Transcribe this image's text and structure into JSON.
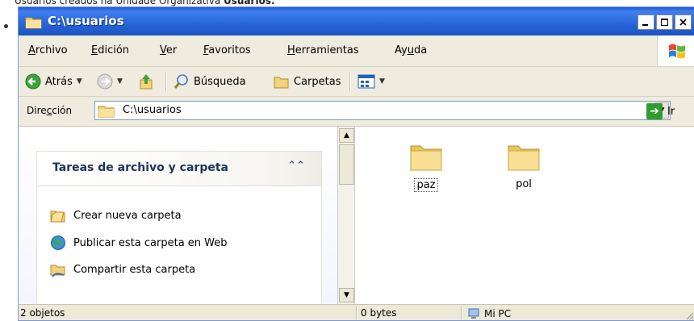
{
  "caption": {
    "prefix": "Usuarios creados na Unidade Organizativa ",
    "bold": "Usuarios."
  },
  "window": {
    "title": "C:\\usuarios"
  },
  "menu": {
    "items": [
      {
        "pre": "",
        "u": "A",
        "post": "rchivo"
      },
      {
        "pre": "",
        "u": "E",
        "post": "dición"
      },
      {
        "pre": "",
        "u": "V",
        "post": "er"
      },
      {
        "pre": "",
        "u": "F",
        "post": "avoritos"
      },
      {
        "pre": "",
        "u": "H",
        "post": "erramientas"
      },
      {
        "pre": "Ay",
        "u": "u",
        "post": "da"
      }
    ]
  },
  "toolbar": {
    "back_label": "Atrás",
    "search_label": "Búsqueda",
    "folders_label": "Carpetas"
  },
  "address": {
    "label_pre": "Dire",
    "label_u": "c",
    "label_post": "ción",
    "value": "C:\\usuarios",
    "go_label": "Ir"
  },
  "tasks": {
    "title": "Tareas de archivo y carpeta",
    "collapse_icon": "double-chevron-up-icon",
    "items": [
      {
        "label": "Crear nueva carpeta",
        "icon": "new-folder-icon"
      },
      {
        "label": "Publicar esta carpeta en Web",
        "icon": "web-publish-icon"
      },
      {
        "label": "Compartir esta carpeta",
        "icon": "share-folder-icon"
      }
    ]
  },
  "files": [
    {
      "name": "paz",
      "selected": true
    },
    {
      "name": "pol",
      "selected": false
    }
  ],
  "status": {
    "objects": "2 objetos",
    "size": "0 bytes",
    "location": "Mi PC"
  },
  "colors": {
    "titlebar": "#2b67d9",
    "window_bg": "#ece9d8",
    "folder": "#f5d77a",
    "go_green": "#2f9e2f",
    "task_title": "#1e3460"
  }
}
